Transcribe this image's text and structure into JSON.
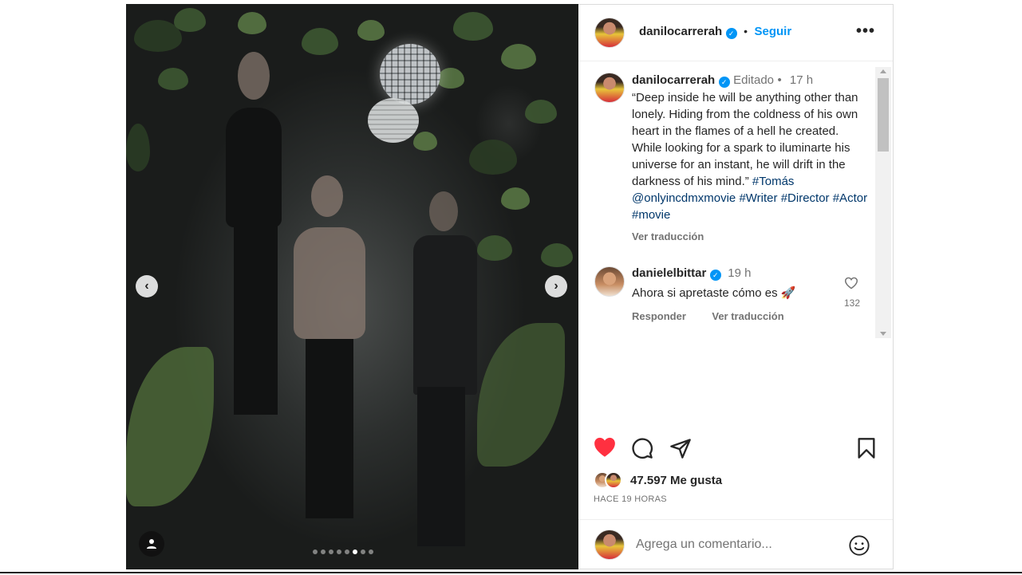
{
  "post": {
    "author": "danilocarrerah",
    "follow_label": "Seguir",
    "more_label": "•••",
    "caption": {
      "edited_label": "Editado",
      "time": "17 h",
      "text": "“Deep inside he will be anything other than lonely. Hiding from the coldness of his own heart in the flames of a hell he created. While looking for a spark to iluminarte his universe for an instant, he will drift in the darkness of his mind.”",
      "tags": [
        "#Tomás",
        "@onlyincdmxmovie",
        "#Writer",
        "#Director",
        "#Actor",
        "#movie"
      ],
      "translate_label": "Ver traducción"
    },
    "comments": [
      {
        "user": "danielelbittar",
        "time": "19 h",
        "text": "Ahora si apretaste cómo es 🚀",
        "likes": "132",
        "reply_label": "Responder",
        "translate_label": "Ver traducción"
      }
    ],
    "likes_text": "47.597 Me gusta",
    "posted_ago": "HACE 19 HORAS",
    "comment_placeholder": "Agrega un comentario...",
    "carousel": {
      "total": 8,
      "active_index": 5
    }
  },
  "colors": {
    "accent": "#0095f6",
    "like": "#ff3040",
    "hashtag": "#00376b",
    "muted": "#737373"
  }
}
